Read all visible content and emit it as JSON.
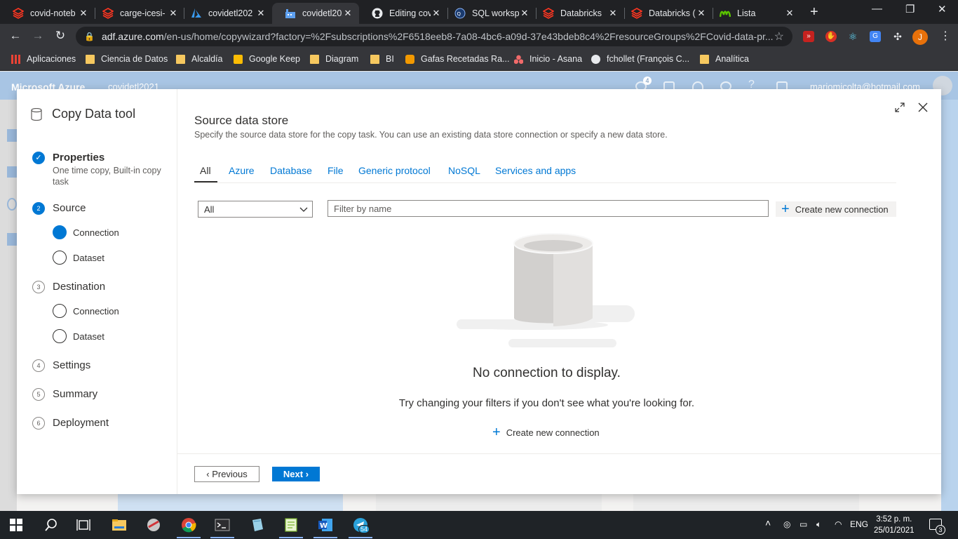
{
  "browser": {
    "tabs": [
      {
        "label": "covid-noteb",
        "icon": "databricks-icon",
        "active": false
      },
      {
        "label": "carge-icesi-",
        "icon": "databricks-icon",
        "active": false
      },
      {
        "label": "covidetl202",
        "icon": "azure-icon",
        "active": false
      },
      {
        "label": "covidetl202",
        "icon": "data-factory-icon",
        "active": true
      },
      {
        "label": "Editing covi",
        "icon": "github-icon",
        "active": false
      },
      {
        "label": "SQL worksp",
        "icon": "sql-icon",
        "active": false
      },
      {
        "label": "Databricks",
        "icon": "databricks-icon",
        "active": false
      },
      {
        "label": "Databricks (",
        "icon": "databricks-icon",
        "active": false
      },
      {
        "label": "Lista",
        "icon": "movistar-icon",
        "active": false
      }
    ],
    "address": {
      "host": "adf.azure.com",
      "path": "/en-us/home/copywizard?factory=%2Fsubscriptions%2F6518eeb8-7a08-4bc6-a09d-37e43bdeb8c4%2FresourceGroups%2FCovid-data-pr..."
    },
    "profile_initial": "J",
    "bookmarks": [
      {
        "label": "Aplicaciones"
      },
      {
        "label": "Ciencia de Datos"
      },
      {
        "label": "Alcaldía"
      },
      {
        "label": "Google Keep"
      },
      {
        "label": "Diagram"
      },
      {
        "label": "BI"
      },
      {
        "label": "Gafas Recetadas Ra..."
      },
      {
        "label": "Inicio - Asana"
      },
      {
        "label": "fchollet (François C..."
      },
      {
        "label": "Analítica"
      }
    ]
  },
  "azure": {
    "brand": "Microsoft Azure",
    "factory": "covidetl2021",
    "user": "mariomicolta@hotmail.com",
    "notification_count": "4"
  },
  "wizard": {
    "title": "Copy Data tool",
    "steps": [
      {
        "num": "✓",
        "label": "Properties",
        "desc": "One time copy, Built-in copy task"
      },
      {
        "num": "2",
        "label": "Source"
      },
      {
        "num": "3",
        "label": "Destination"
      },
      {
        "num": "4",
        "label": "Settings"
      },
      {
        "num": "5",
        "label": "Summary"
      },
      {
        "num": "6",
        "label": "Deployment"
      }
    ],
    "source_substeps": [
      "Connection",
      "Dataset"
    ],
    "destination_substeps": [
      "Connection",
      "Dataset"
    ]
  },
  "content": {
    "title": "Source data store",
    "description": "Specify the source data store for the copy task. You can use an existing data store connection or specify a new data store.",
    "tabs": [
      "All",
      "Azure",
      "Database",
      "File",
      "Generic protocol",
      "NoSQL",
      "Services and apps"
    ],
    "type_filter": "All",
    "filter_placeholder": "Filter by name",
    "create_connection_label": "Create new connection",
    "empty_message": "No connection to display.",
    "empty_hint": "Try changing your filters if you don't see what you're looking for.",
    "create_connection_bottom": "Create new connection",
    "previous_label": "Previous",
    "next_label": "Next"
  },
  "taskbar": {
    "language": "ENG",
    "time": "3:52 p. m.",
    "date": "25/01/2021",
    "telegram_badge": "54",
    "notification_badge": "3"
  },
  "colors": {
    "accent": "#0078d4",
    "chrome_dark": "#202124",
    "chrome_toolbar": "#35363a"
  }
}
